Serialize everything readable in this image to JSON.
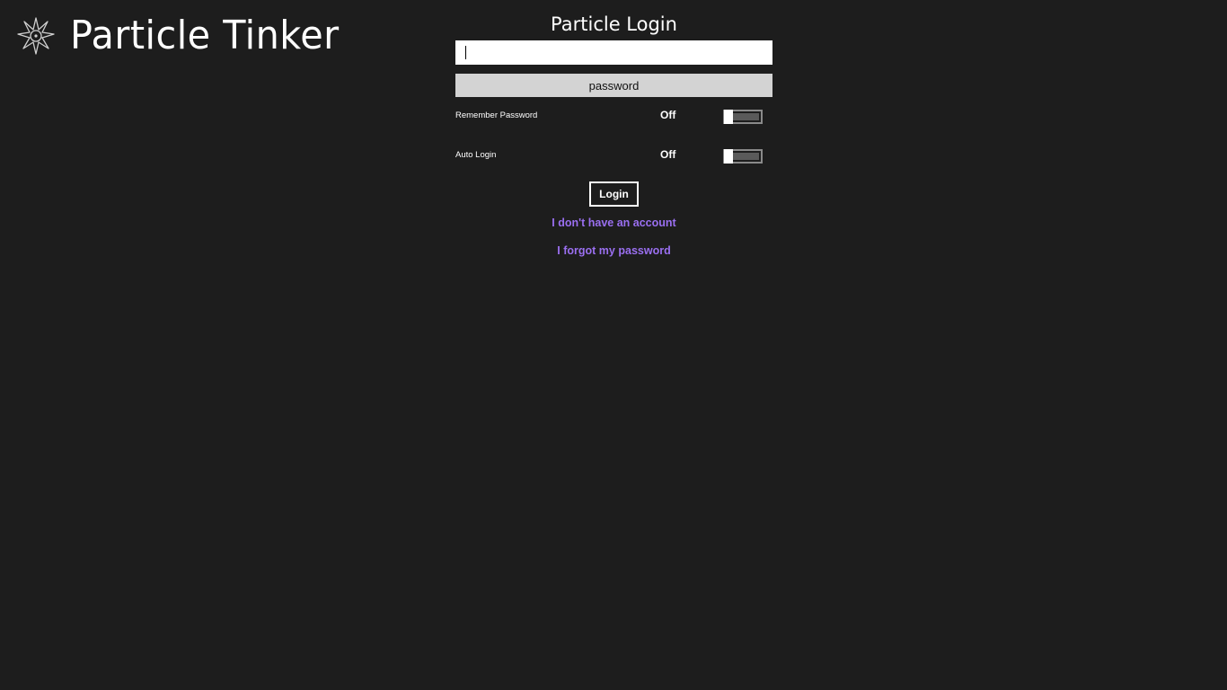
{
  "app": {
    "title": "Particle Tinker",
    "logo_icon": "starburst-logo-icon"
  },
  "login": {
    "title": "Particle Login",
    "username": {
      "value": "",
      "placeholder": ""
    },
    "password": {
      "placeholder": "password"
    },
    "remember_password": {
      "label": "Remember Password",
      "state": "Off",
      "on": false
    },
    "auto_login": {
      "label": "Auto Login",
      "state": "Off",
      "on": false
    },
    "login_button": "Login",
    "no_account_link": "I don't have an account",
    "forgot_password_link": "I forgot my password"
  },
  "colors": {
    "background": "#1d1d1d",
    "text": "#ffffff",
    "link": "#9a6ff0",
    "password_field": "#d3d3d3"
  }
}
